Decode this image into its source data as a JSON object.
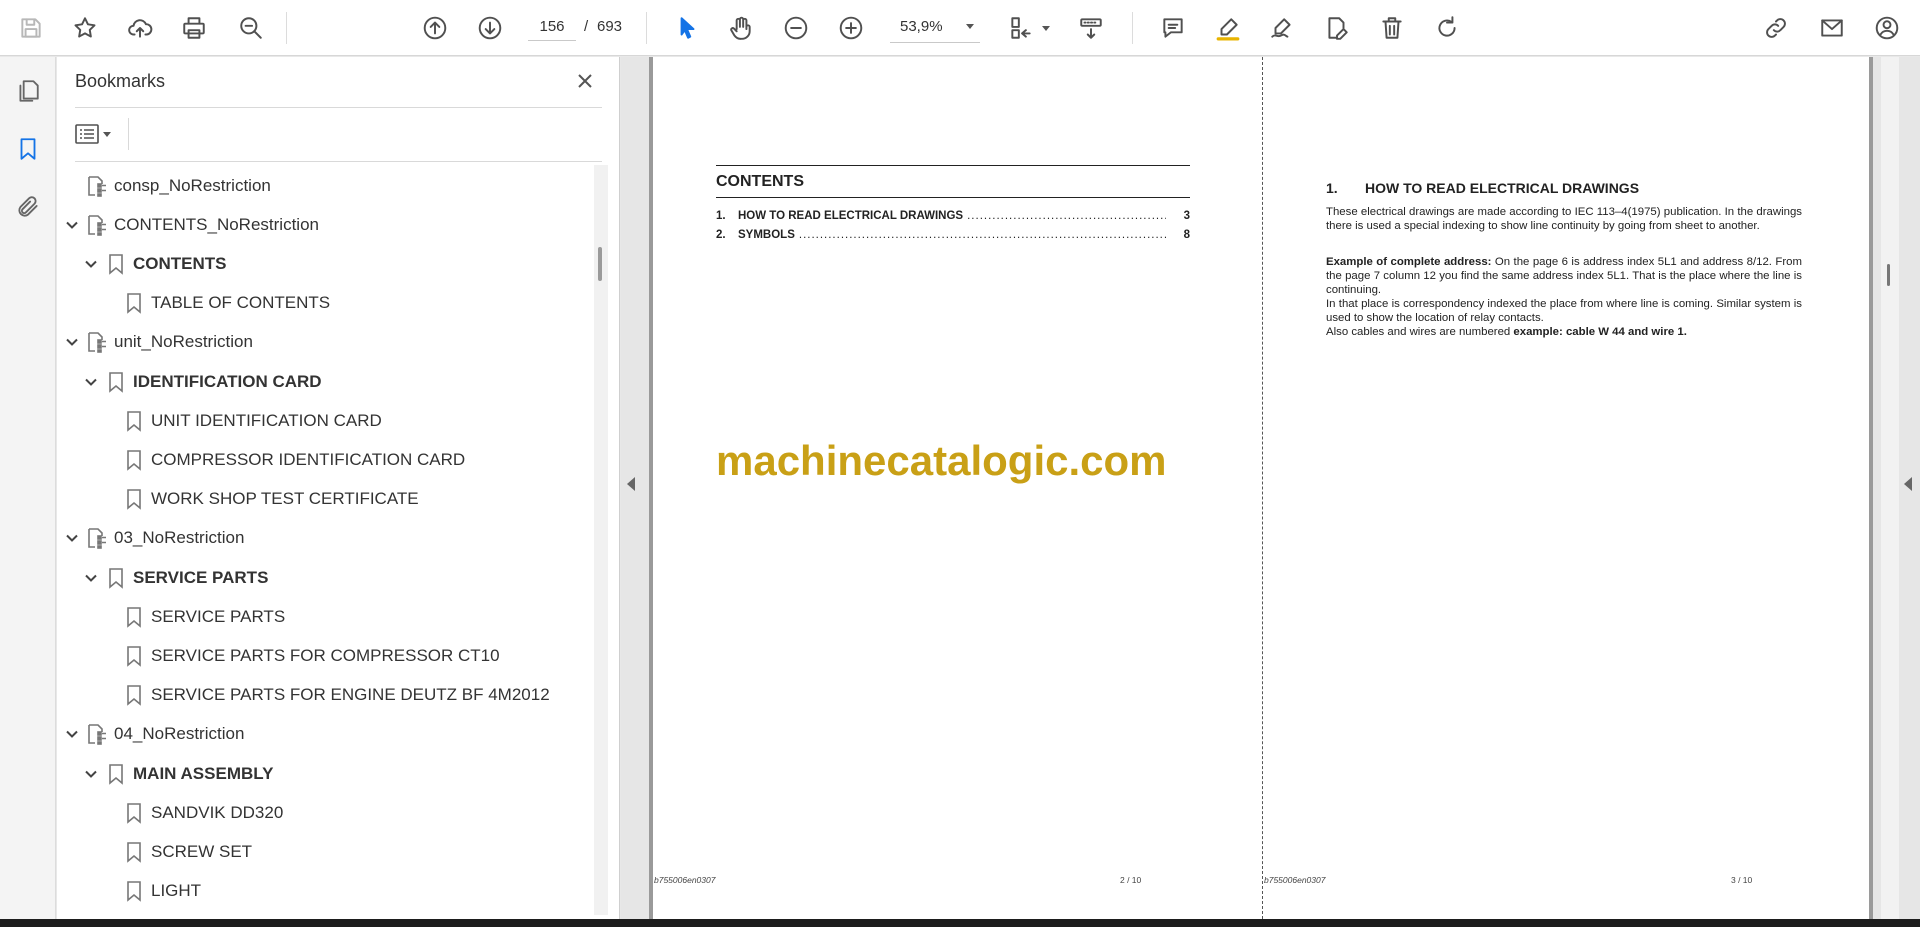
{
  "toolbar": {
    "buttons": [
      "save-icon",
      "star-icon",
      "upload-icon",
      "print-icon",
      "zoom-search-icon",
      "prev-page-icon",
      "next-page-icon",
      "select-tool-icon",
      "hand-tool-icon",
      "zoom-out-icon",
      "zoom-in-icon",
      "fit-page-icon",
      "scroll-mode-icon",
      "comment-icon",
      "highlight-icon",
      "sign-icon",
      "edit-icon",
      "delete-icon",
      "rotate-icon",
      "share-link-icon",
      "email-icon",
      "account-icon"
    ],
    "current_page": "156",
    "page_separator": "/",
    "total_pages": "693",
    "zoom": "53,9%"
  },
  "bookmarks": {
    "title": "Bookmarks",
    "items": [
      {
        "label": "consp_NoRestriction",
        "level": 0,
        "toggle": "none",
        "icon": "file-tree-icon",
        "bold": false
      },
      {
        "label": "CONTENTS_NoRestriction",
        "level": 0,
        "toggle": "expanded",
        "icon": "file-tree-icon",
        "bold": false
      },
      {
        "label": "CONTENTS",
        "level": 1,
        "toggle": "expanded",
        "icon": "bookmark-icon",
        "bold": true
      },
      {
        "label": "TABLE OF CONTENTS",
        "level": 2,
        "toggle": "none",
        "icon": "bookmark-icon",
        "bold": false
      },
      {
        "label": "unit_NoRestriction",
        "level": 0,
        "toggle": "expanded",
        "icon": "file-tree-icon",
        "bold": false
      },
      {
        "label": "IDENTIFICATION CARD",
        "level": 1,
        "toggle": "expanded",
        "icon": "bookmark-icon",
        "bold": true
      },
      {
        "label": "UNIT IDENTIFICATION CARD",
        "level": 2,
        "toggle": "none",
        "icon": "bookmark-icon",
        "bold": false
      },
      {
        "label": "COMPRESSOR IDENTIFICATION CARD",
        "level": 2,
        "toggle": "none",
        "icon": "bookmark-icon",
        "bold": false
      },
      {
        "label": "WORK SHOP TEST CERTIFICATE",
        "level": 2,
        "toggle": "none",
        "icon": "bookmark-icon",
        "bold": false
      },
      {
        "label": "03_NoRestriction",
        "level": 0,
        "toggle": "expanded",
        "icon": "file-tree-icon",
        "bold": false
      },
      {
        "label": "SERVICE PARTS",
        "level": 1,
        "toggle": "expanded",
        "icon": "bookmark-icon",
        "bold": true
      },
      {
        "label": "SERVICE PARTS",
        "level": 2,
        "toggle": "none",
        "icon": "bookmark-icon",
        "bold": false
      },
      {
        "label": "SERVICE PARTS FOR COMPRESSOR CT10",
        "level": 2,
        "toggle": "none",
        "icon": "bookmark-icon",
        "bold": false
      },
      {
        "label": "SERVICE PARTS FOR ENGINE DEUTZ BF 4M2012",
        "level": 2,
        "toggle": "none",
        "icon": "bookmark-icon",
        "bold": false
      },
      {
        "label": "04_NoRestriction",
        "level": 0,
        "toggle": "expanded",
        "icon": "file-tree-icon",
        "bold": false
      },
      {
        "label": "MAIN ASSEMBLY",
        "level": 1,
        "toggle": "expanded",
        "icon": "bookmark-icon",
        "bold": true
      },
      {
        "label": "SANDVIK DD320",
        "level": 2,
        "toggle": "none",
        "icon": "bookmark-icon",
        "bold": false
      },
      {
        "label": "SCREW SET",
        "level": 2,
        "toggle": "none",
        "icon": "bookmark-icon",
        "bold": false
      },
      {
        "label": "LIGHT",
        "level": 2,
        "toggle": "none",
        "icon": "bookmark-icon",
        "bold": false
      }
    ]
  },
  "left_page": {
    "heading": "CONTENTS",
    "toc": [
      {
        "num": "1.",
        "title": "HOW TO READ ELECTRICAL DRAWINGS",
        "page": "3"
      },
      {
        "num": "2.",
        "title": "SYMBOLS",
        "page": "8"
      }
    ],
    "watermark": "machinecatalogic.com",
    "footer_code": "b755006en0307",
    "footer_page": "2 / 10"
  },
  "right_page": {
    "section_num": "1.",
    "section_title": "HOW TO READ ELECTRICAL DRAWINGS",
    "para1": "These electrical drawings are made according to IEC 113–4(1975) publication. In the drawings there is used a special indexing to show line continuity by going from sheet to another.",
    "para2_bold": "Example of complete address:",
    "para2": " On the page 6  is address index 5L1 and address 8/12. From the page 7 column 12 you find the same address index 5L1. That is the place where the line is continuing.",
    "para3": "In that place is correspondency indexed the place from where line is coming. Similar system is used to show the location of relay contacts.",
    "para4": "Also cables and wires are numbered ",
    "para4_bold": "example: cable W 44 and wire 1.",
    "footer_code": "b755006en0307",
    "footer_page": "3 / 10"
  }
}
